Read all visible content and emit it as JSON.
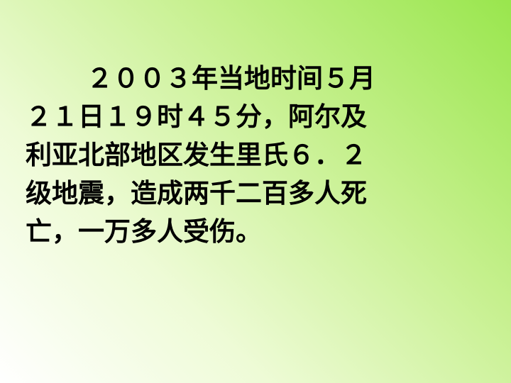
{
  "slide": {
    "lines": [
      "２００３年当地时间５月",
      "２１日１９时４５分，阿尔及",
      "利亚北部地区发生里氏６．２",
      "级地震，造成两千二百多人死",
      "亡，一万多人受伤。"
    ]
  },
  "colors": {
    "background_top_right": "#99e64d",
    "background_bottom_left": "#ffffff",
    "text": "#000000"
  }
}
